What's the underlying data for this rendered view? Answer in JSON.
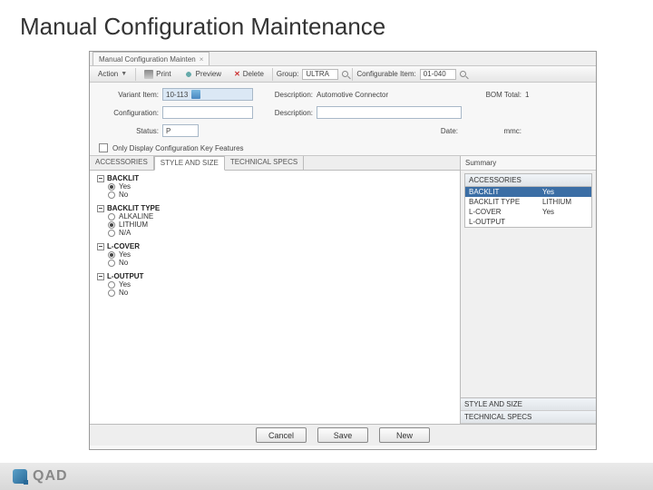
{
  "slide": {
    "title": "Manual Configuration Maintenance"
  },
  "window": {
    "tab": {
      "title": "Manual Configuration Mainten",
      "close": "×"
    },
    "toolbar": {
      "action": "Action",
      "print": "Print",
      "preview": "Preview",
      "delete": "Delete",
      "group_label": "Group:",
      "group_value": "ULTRA",
      "citem_label": "Configurable Item:",
      "citem_value": "01-040"
    },
    "form": {
      "var_item_label": "Variant Item:",
      "var_item_value": "10-113",
      "desc1_label": "Description:",
      "desc1_value": "Automotive Connector",
      "bom_label": "BOM Total:",
      "bom_value": "1",
      "config_label": "Configuration:",
      "desc2_label": "Description:",
      "status_label": "Status:",
      "status_value": "P",
      "date_label": "Date:",
      "mmc_label": "mmc:"
    },
    "chk_label": "Only Display Configuration Key Features",
    "left_tabs": [
      "ACCESSORIES",
      "STYLE AND SIZE",
      "TECHNICAL SPECS"
    ],
    "groups": [
      {
        "name": "BACKLIT",
        "opts": [
          {
            "label": "Yes",
            "sel": true
          },
          {
            "label": "No",
            "sel": false
          }
        ]
      },
      {
        "name": "BACKLIT TYPE",
        "opts": [
          {
            "label": "ALKALINE",
            "sel": false
          },
          {
            "label": "LITHIUM",
            "sel": true
          },
          {
            "label": "N/A",
            "sel": false
          }
        ]
      },
      {
        "name": "L-COVER",
        "opts": [
          {
            "label": "Yes",
            "sel": true
          },
          {
            "label": "No",
            "sel": false
          }
        ]
      },
      {
        "name": "L-OUTPUT",
        "opts": [
          {
            "label": "Yes",
            "sel": false
          },
          {
            "label": "No",
            "sel": false
          }
        ]
      }
    ],
    "summary": {
      "title": "Summary",
      "sections": {
        "accessories_h": "ACCESSORIES",
        "rows": [
          {
            "k": "BACKLIT",
            "v": "Yes",
            "sel": true
          },
          {
            "k": "BACKLIT TYPE",
            "v": "LITHIUM",
            "sel": false
          },
          {
            "k": "L-COVER",
            "v": "Yes",
            "sel": false
          },
          {
            "k": "L-OUTPUT",
            "v": "",
            "sel": false
          }
        ],
        "style_h": "STYLE AND SIZE",
        "tech_h": "TECHNICAL SPECS"
      }
    },
    "buttons": {
      "cancel": "Cancel",
      "save": "Save",
      "new": "New"
    }
  },
  "footer": {
    "brand": "QAD"
  }
}
